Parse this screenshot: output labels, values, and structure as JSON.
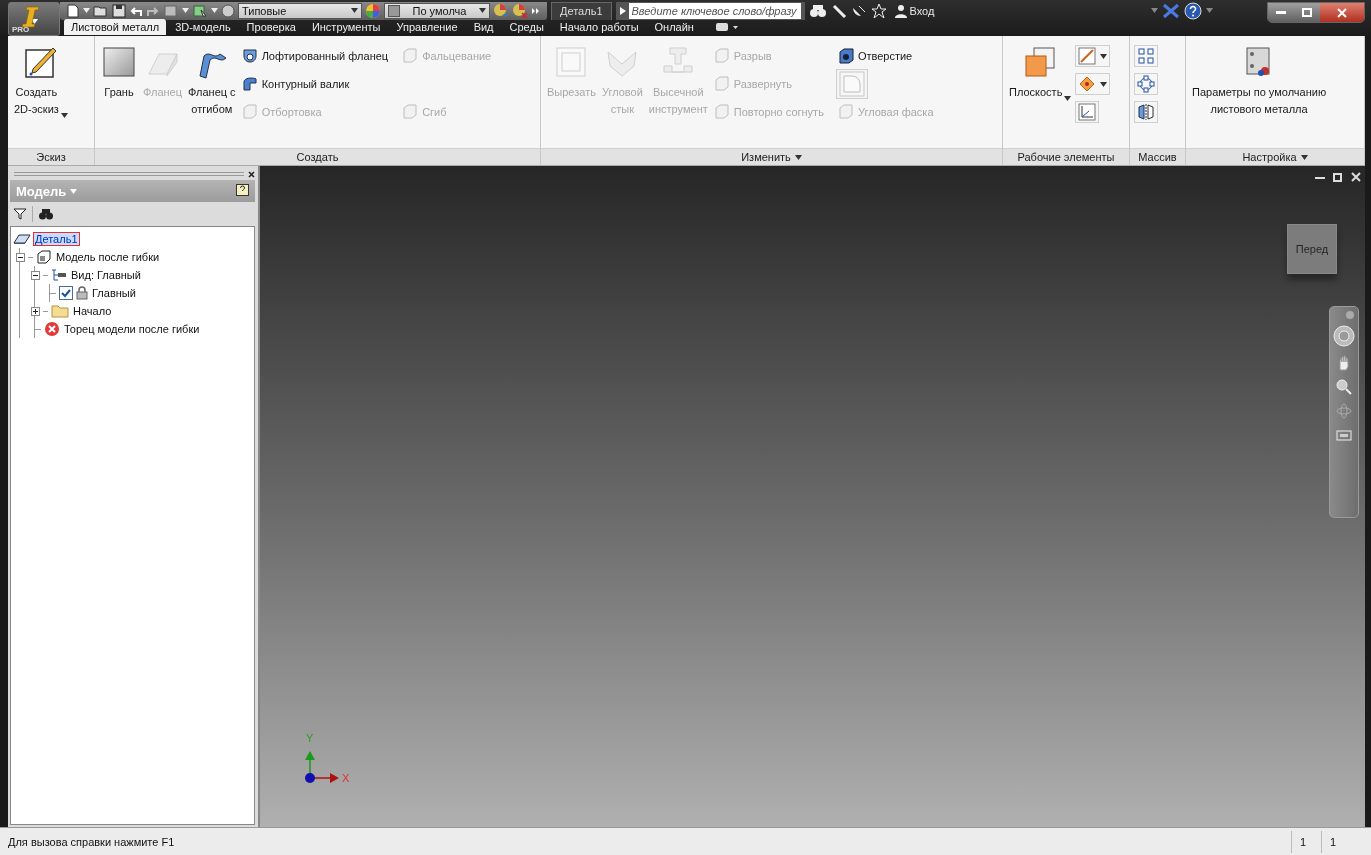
{
  "app_button": {
    "edition": "PRO"
  },
  "quick_access": {
    "style_combo": "Типовые",
    "material_combo": "По умолча"
  },
  "document_tab": "Деталь1",
  "search": {
    "placeholder": "Введите ключевое слово/фразу"
  },
  "sign_in": "Вход",
  "ribbon_tabs": [
    {
      "label": "Листовой металл",
      "selected": true
    },
    {
      "label": "3D-модель",
      "selected": false
    },
    {
      "label": "Проверка",
      "selected": false
    },
    {
      "label": "Инструменты",
      "selected": false
    },
    {
      "label": "Управление",
      "selected": false
    },
    {
      "label": "Вид",
      "selected": false
    },
    {
      "label": "Среды",
      "selected": false
    },
    {
      "label": "Начало работы",
      "selected": false
    },
    {
      "label": "Онлайн",
      "selected": false
    }
  ],
  "ribbon_groups": [
    {
      "title": "Эскиз",
      "menu": false,
      "large": [
        {
          "label": "Создать\n2D-эскиз",
          "disabled": false,
          "dropdown": true
        }
      ]
    },
    {
      "title": "Создать",
      "menu": false,
      "large": [
        {
          "label": "Грань",
          "disabled": false,
          "dropdown": false
        },
        {
          "label": "Фланец",
          "disabled": true,
          "dropdown": false
        },
        {
          "label": "Фланец с\nотгибом",
          "disabled": false,
          "dropdown": false
        }
      ],
      "small_rows": [
        [
          {
            "label": "Лофтированный фланец",
            "disabled": false,
            "dropdown": false
          },
          {
            "label": "Фальцевание",
            "disabled": true,
            "dropdown": false
          }
        ],
        [
          {
            "label": "Контурный валик",
            "disabled": false,
            "dropdown": false
          }
        ],
        [
          {
            "label": "Отбортовка",
            "disabled": true,
            "dropdown": false
          },
          {
            "label": "Сгиб",
            "disabled": true,
            "dropdown": false
          }
        ]
      ]
    },
    {
      "title": "Изменить",
      "menu": true,
      "large": [
        {
          "label": "Вырезать",
          "disabled": true,
          "dropdown": false
        },
        {
          "label": "Угловой\nстык",
          "disabled": true,
          "dropdown": false
        },
        {
          "label": "Высечной\nинструмент",
          "disabled": true,
          "dropdown": false
        }
      ],
      "small_rows": [
        [
          {
            "label": "Разрыв",
            "disabled": true,
            "dropdown": false
          },
          {
            "label": "Отверстие",
            "disabled": false,
            "dropdown": false
          }
        ],
        [
          {
            "label": "Развернуть",
            "disabled": true,
            "dropdown": false
          },
          {
            "disabled": true,
            "dropdown": false
          }
        ],
        [
          {
            "label": "Повторно согнуть",
            "disabled": true,
            "dropdown": false
          },
          {
            "label": "Угловая фаска",
            "disabled": true,
            "dropdown": false
          }
        ]
      ]
    },
    {
      "title": "Рабочие элементы",
      "menu": false,
      "large": [
        {
          "label": "Плоскость",
          "disabled": false,
          "dropdown": true
        }
      ],
      "small_rows": [
        [
          {
            "disabled": false,
            "dropdown": true
          }
        ],
        [
          {
            "disabled": false,
            "dropdown": true
          }
        ],
        [
          {
            "disabled": false,
            "dropdown": false
          }
        ]
      ]
    },
    {
      "title": "Массив",
      "menu": false,
      "small_rows": [
        [
          {
            "disabled": false,
            "dropdown": false
          }
        ],
        [
          {
            "disabled": false,
            "dropdown": false
          }
        ],
        [
          {
            "disabled": false,
            "dropdown": false
          }
        ]
      ]
    },
    {
      "title": "Настройка",
      "menu": true,
      "large": [
        {
          "label": "Параметры по умолчанию\nлистового металла",
          "disabled": false,
          "dropdown": false
        }
      ]
    }
  ],
  "browser": {
    "title": "Модель",
    "tree": [
      {
        "label": "Деталь1",
        "kind": "part",
        "selected": true,
        "children": [
          {
            "label": "Модель после гибки",
            "kind": "model",
            "selected": false,
            "expanded": true,
            "children": [
              {
                "label": "Вид: Главный",
                "kind": "view",
                "selected": false,
                "expanded": true,
                "children": [
                  {
                    "label": "Главный",
                    "kind": "representation",
                    "selected": false,
                    "checked": true
                  }
                ]
              },
              {
                "label": "Начало",
                "kind": "folder",
                "selected": false,
                "expanded": false
              },
              {
                "label": "Торец модели после гибки",
                "kind": "error",
                "selected": false
              }
            ]
          }
        ]
      }
    ]
  },
  "viewport": {
    "view_cube": "Перед",
    "axes": {
      "x": "X",
      "y": "Y"
    }
  },
  "status_bar": {
    "message": "Для вызова справки нажмите F1",
    "fields": [
      "1",
      "1"
    ]
  }
}
